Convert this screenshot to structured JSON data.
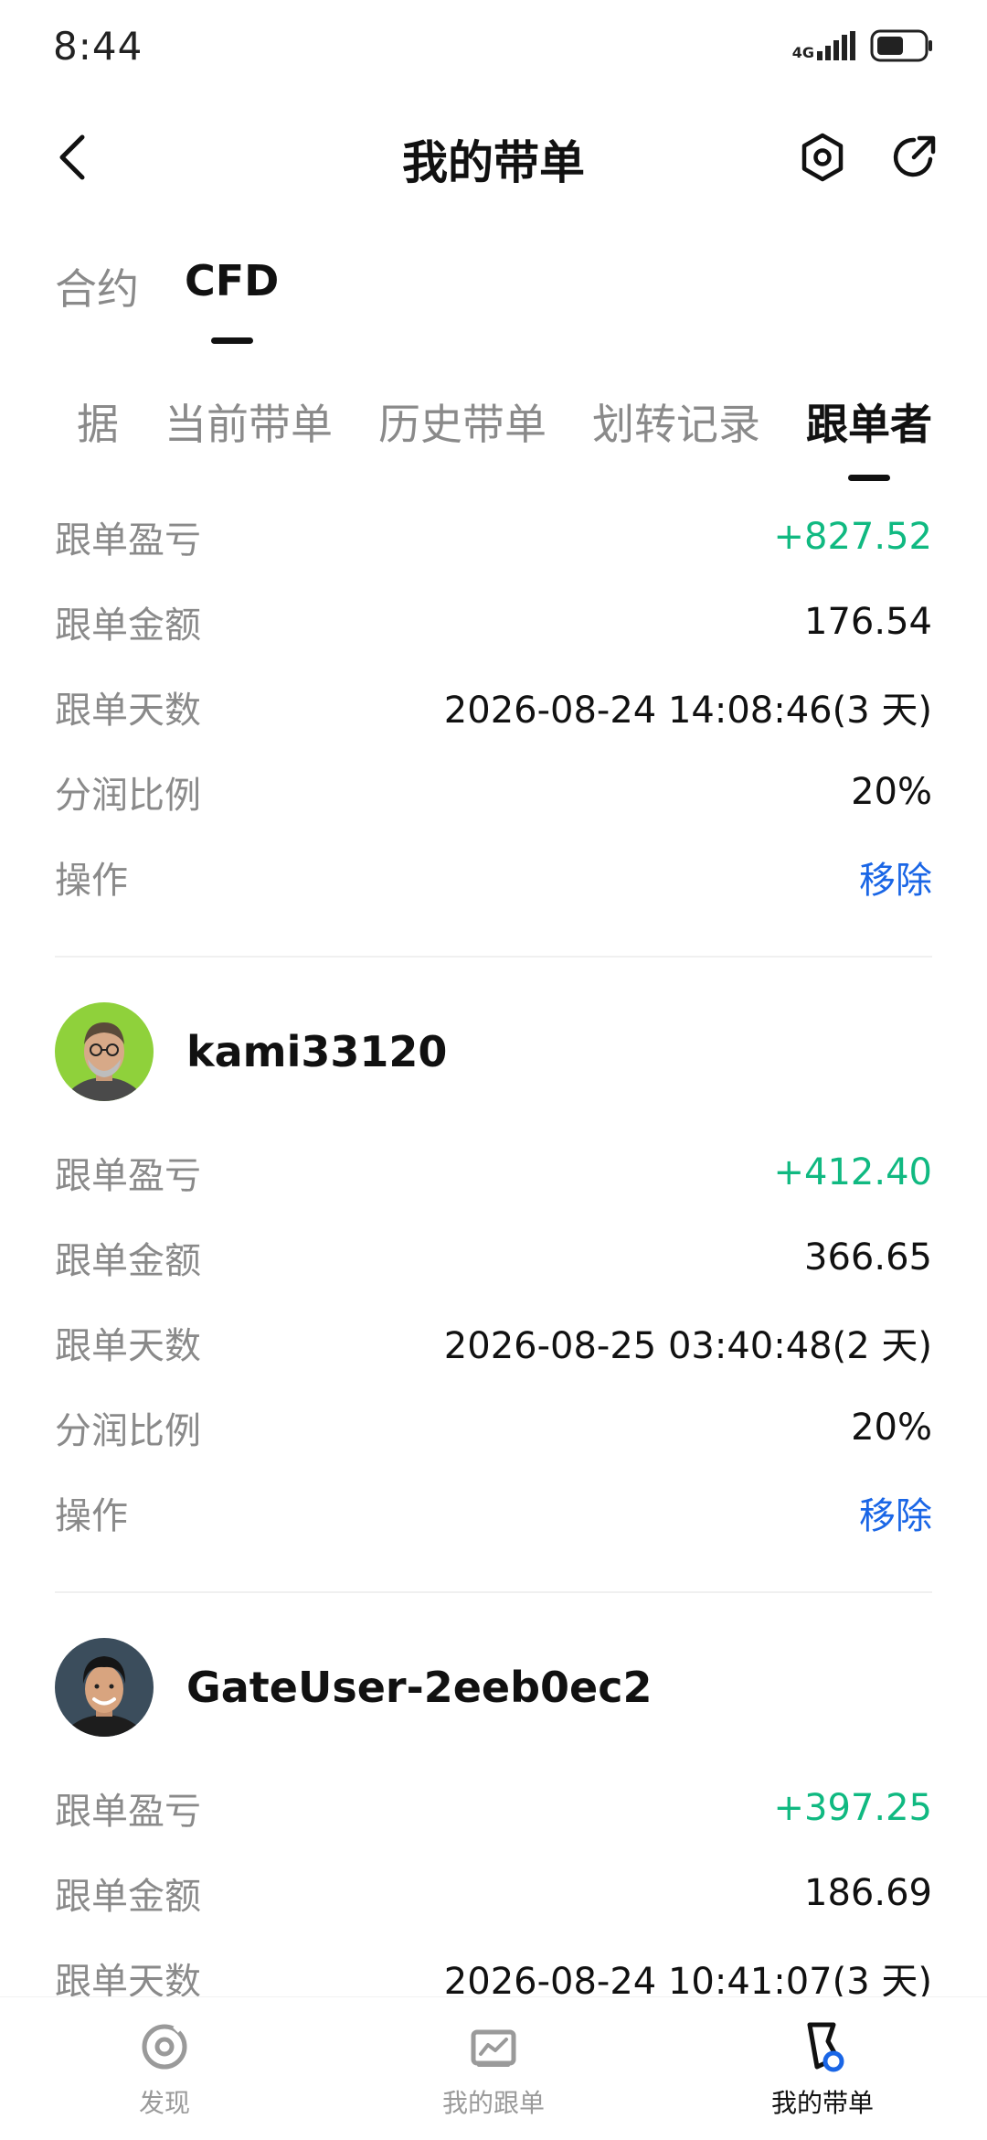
{
  "status_bar": {
    "time": "8:44",
    "network": "4G",
    "icons": [
      "signal-icon",
      "battery-icon"
    ]
  },
  "header": {
    "title": "我的带单",
    "icons": [
      "back-icon",
      "settings-icon",
      "share-icon"
    ]
  },
  "product_tabs": [
    {
      "label": "合约",
      "active": false
    },
    {
      "label": "CFD",
      "active": true
    }
  ],
  "sub_tabs": [
    {
      "label": "据",
      "active": false
    },
    {
      "label": "当前带单",
      "active": false
    },
    {
      "label": "历史带单",
      "active": false
    },
    {
      "label": "划转记录",
      "active": false
    },
    {
      "label": "跟单者",
      "active": true
    }
  ],
  "followers": [
    {
      "username": "",
      "rows": [
        {
          "label": "跟单盈亏",
          "value": "+827.52",
          "type": "profit"
        },
        {
          "label": "跟单金额",
          "value": "176.54",
          "type": "normal"
        },
        {
          "label": "跟单天数",
          "value": "2026-08-24 14:08:46(3 天)",
          "type": "normal"
        },
        {
          "label": "分润比例",
          "value": "20%",
          "type": "normal"
        },
        {
          "label": "操作",
          "value": "移除",
          "type": "action"
        }
      ]
    },
    {
      "username": "kami33120",
      "rows": [
        {
          "label": "跟单盈亏",
          "value": "+412.40",
          "type": "profit"
        },
        {
          "label": "跟单金额",
          "value": "366.65",
          "type": "normal"
        },
        {
          "label": "跟单天数",
          "value": "2026-08-25 03:40:48(2 天)",
          "type": "normal"
        },
        {
          "label": "分润比例",
          "value": "20%",
          "type": "normal"
        },
        {
          "label": "操作",
          "value": "移除",
          "type": "action"
        }
      ]
    },
    {
      "username": "GateUser-2eeb0ec2",
      "rows": [
        {
          "label": "跟单盈亏",
          "value": "+397.25",
          "type": "profit"
        },
        {
          "label": "跟单金额",
          "value": "186.69",
          "type": "normal"
        },
        {
          "label": "跟单天数",
          "value": "2026-08-24 10:41:07(3 天)",
          "type": "normal"
        }
      ]
    }
  ],
  "bottom_nav": [
    {
      "label": "发现",
      "icon": "discover-icon",
      "active": false
    },
    {
      "label": "我的跟单",
      "icon": "my-copy-icon",
      "active": false
    },
    {
      "label": "我的带单",
      "icon": "my-lead-icon",
      "active": true
    }
  ],
  "colors": {
    "profit": "#10b981",
    "action": "#1a66e6",
    "muted": "#8a8a8a",
    "text": "#111111"
  }
}
